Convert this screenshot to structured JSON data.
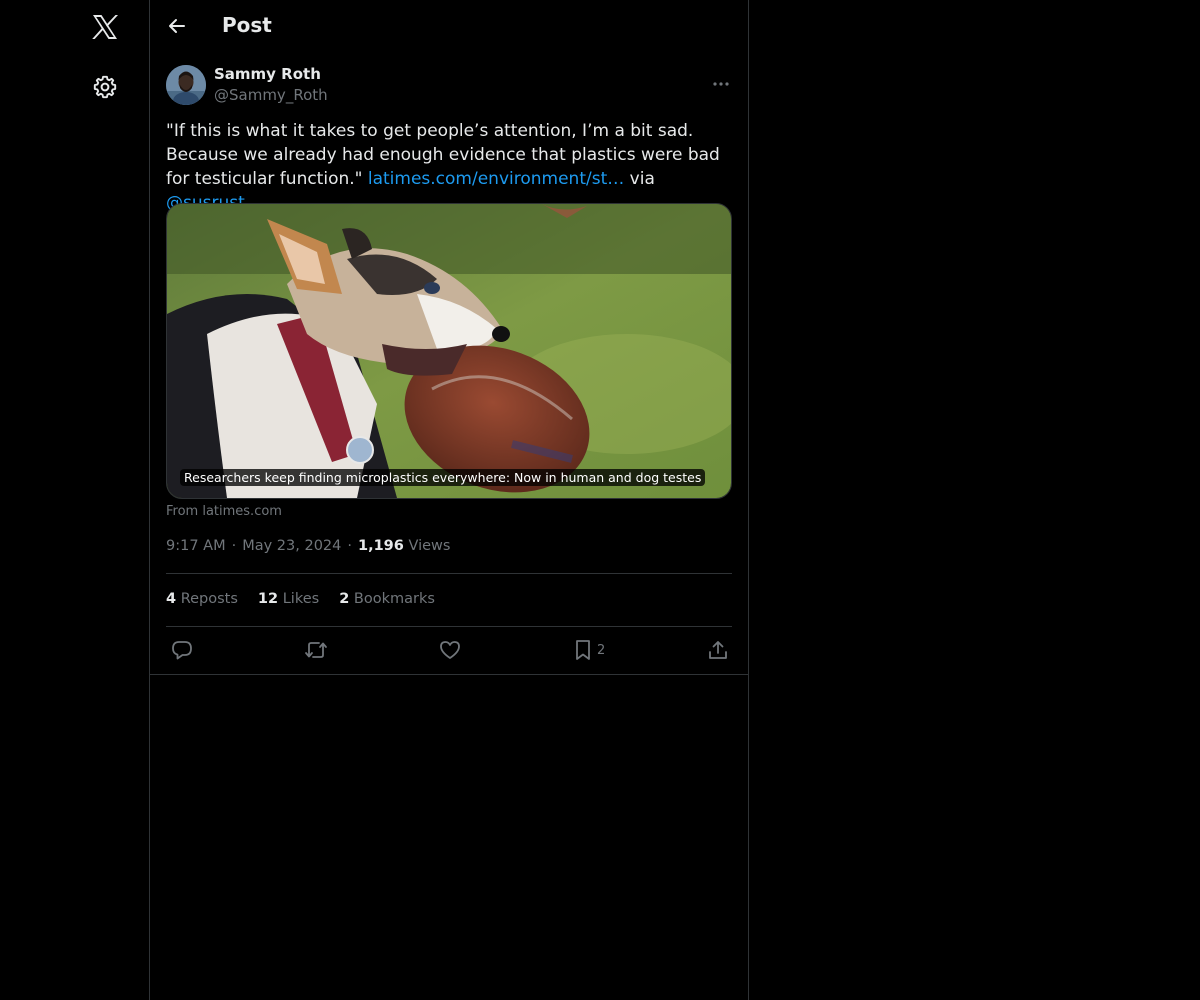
{
  "header": {
    "title": "Post"
  },
  "post": {
    "author_name": "Sammy Roth",
    "author_handle": "@Sammy_Roth",
    "text_quote": "\"If this is what it takes to get people’s attention, I’m a bit sad. Because we already had enough evidence that plastics were bad for testicular function.\" ",
    "text_link": "latimes.com/environment/st…",
    "text_via": " via ",
    "text_mention": "@susrust",
    "card": {
      "caption": "Researchers keep finding microplastics everywhere: Now in human and dog testes",
      "source": "From latimes.com"
    },
    "meta": {
      "time": "9:17 AM",
      "date": "May 23, 2024",
      "views_count": "1,196",
      "views_label": "Views",
      "separator": "·"
    },
    "stats": {
      "reposts_count": "4",
      "reposts_label": "Reposts",
      "likes_count": "12",
      "likes_label": "Likes",
      "bookmarks_count": "2",
      "bookmarks_label": "Bookmarks"
    },
    "actions": {
      "bookmark_count": "2"
    }
  },
  "icons": [
    "x-logo-icon",
    "gear-icon",
    "back-arrow-icon",
    "more-icon",
    "reply-icon",
    "repost-icon",
    "like-icon",
    "bookmark-icon",
    "share-icon"
  ],
  "colors": {
    "background": "#000000",
    "text": "#e7e9ea",
    "muted": "#71767b",
    "link": "#1d9bf0",
    "border": "#2f3336"
  }
}
